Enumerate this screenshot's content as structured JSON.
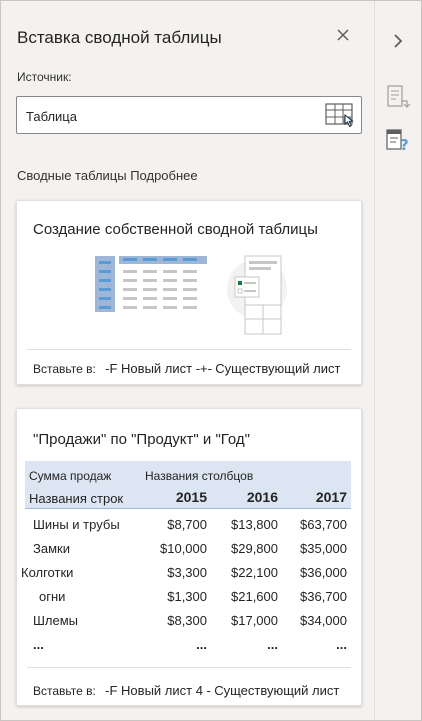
{
  "panel": {
    "title": "Вставка сводной таблицы",
    "source_label": "Источник:",
    "source_value": "Таблица",
    "section_label": "Сводные таблицы Подробнее"
  },
  "colors": {
    "accent": "#5b9bd5",
    "table_header_bg": "#dce6f2",
    "panel_bg": "#f3f2f1"
  },
  "custom_card": {
    "title": "Создание собственной сводной таблицы",
    "insert_label": "Вставьте в:",
    "new_sheet": "-F Новый лист -+-",
    "existing_sheet": "Существующий лист"
  },
  "recommended_card": {
    "title": "\"Продажи\" по \"Продукт\" и \"Год\"",
    "value_label": "Сумма продаж",
    "columns_label": "Названия столбцов",
    "rows_label": "Названия строк",
    "years": [
      "2015",
      "2016",
      "2017"
    ],
    "rows": [
      {
        "name": "Шины и трубы",
        "values": [
          "$8,700",
          "$13,800",
          "$63,700"
        ]
      },
      {
        "name": "Замки",
        "values": [
          "$10,000",
          "$29,800",
          "$35,000"
        ]
      },
      {
        "name": "Колготки",
        "values": [
          "$3,300",
          "$22,100",
          "$36,000"
        ]
      },
      {
        "name": "огни",
        "values": [
          "$1,300",
          "$21,600",
          "$36,700"
        ]
      },
      {
        "name": "Шлемы",
        "values": [
          "$8,300",
          "$17,000",
          "$34,000"
        ]
      }
    ],
    "ellipsis": "...",
    "insert_label": "Вставьте в:",
    "new_sheet": "-F Новый лист 4 -",
    "existing_sheet": "Существующий лист"
  },
  "rail": {
    "collapse_icon": "chevron-right-icon",
    "icons": [
      "pivot-fields-icon",
      "pivot-help-icon"
    ]
  }
}
